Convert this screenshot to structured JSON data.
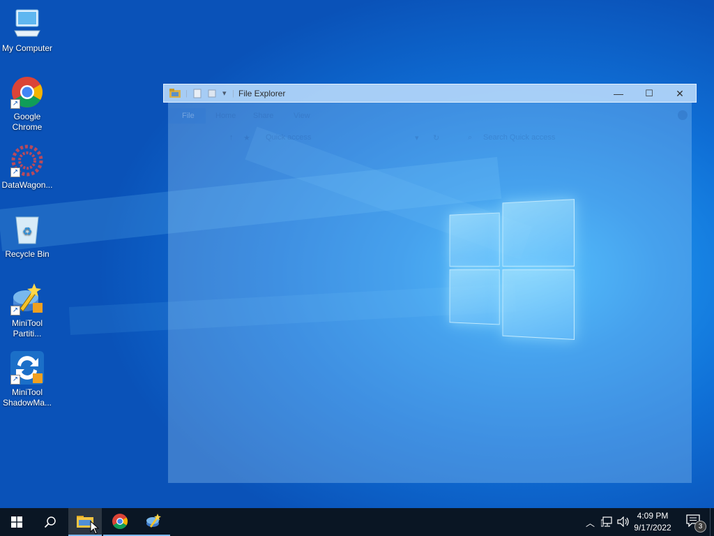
{
  "desktop": {
    "icons": [
      {
        "label": "My Computer",
        "icon": "computer-icon"
      },
      {
        "label": "Google Chrome",
        "icon": "chrome-icon"
      },
      {
        "label": "DataWagon...",
        "icon": "datawagon-icon"
      },
      {
        "label": "Recycle Bin",
        "icon": "recycle-bin-icon"
      },
      {
        "label": "MiniTool Partiti...",
        "icon": "minitool-partition-icon"
      },
      {
        "label": "MiniTool ShadowMa...",
        "icon": "minitool-shadowmaker-icon"
      }
    ]
  },
  "explorer": {
    "title": "File Explorer",
    "ribbon_tabs": [
      "File",
      "Home",
      "Share",
      "View"
    ],
    "address": "Quick access",
    "search_placeholder": "Search Quick access",
    "controls": {
      "minimize": "—",
      "maximize": "☐",
      "close": "✕"
    }
  },
  "taskbar": {
    "time": "4:09 PM",
    "date": "9/17/2022",
    "notification_count": "3",
    "colors": {
      "background": "#0a1624",
      "accent": "#7bb8ef"
    }
  }
}
